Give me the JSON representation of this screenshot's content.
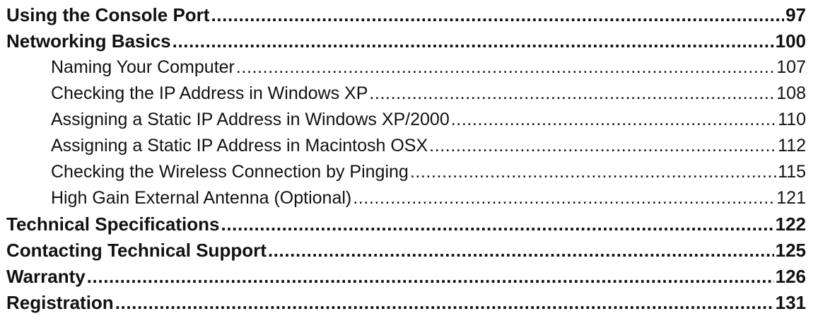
{
  "toc": {
    "entries": [
      {
        "title": "Using the Console Port",
        "page": "97",
        "level": 1
      },
      {
        "title": "Networking Basics",
        "page": "100",
        "level": 1
      },
      {
        "title": "Naming Your Computer",
        "page": "107",
        "level": 2
      },
      {
        "title": "Checking the IP Address in Windows XP",
        "page": "108",
        "level": 2
      },
      {
        "title": "Assigning a Static IP Address in Windows XP/2000",
        "page": "110",
        "level": 2
      },
      {
        "title": "Assigning a Static IP Address in Macintosh OSX",
        "page": "112",
        "level": 2
      },
      {
        "title": "Checking the Wireless Connection by Pinging",
        "page": "115",
        "level": 2
      },
      {
        "title": "High Gain External Antenna (Optional)",
        "page": "121",
        "level": 2
      },
      {
        "title": "Technical Specifications",
        "page": "122",
        "level": 1
      },
      {
        "title": "Contacting Technical Support",
        "page": "125",
        "level": 1
      },
      {
        "title": "Warranty",
        "page": "126",
        "level": 1
      },
      {
        "title": "Registration",
        "page": "131",
        "level": 1
      }
    ]
  }
}
